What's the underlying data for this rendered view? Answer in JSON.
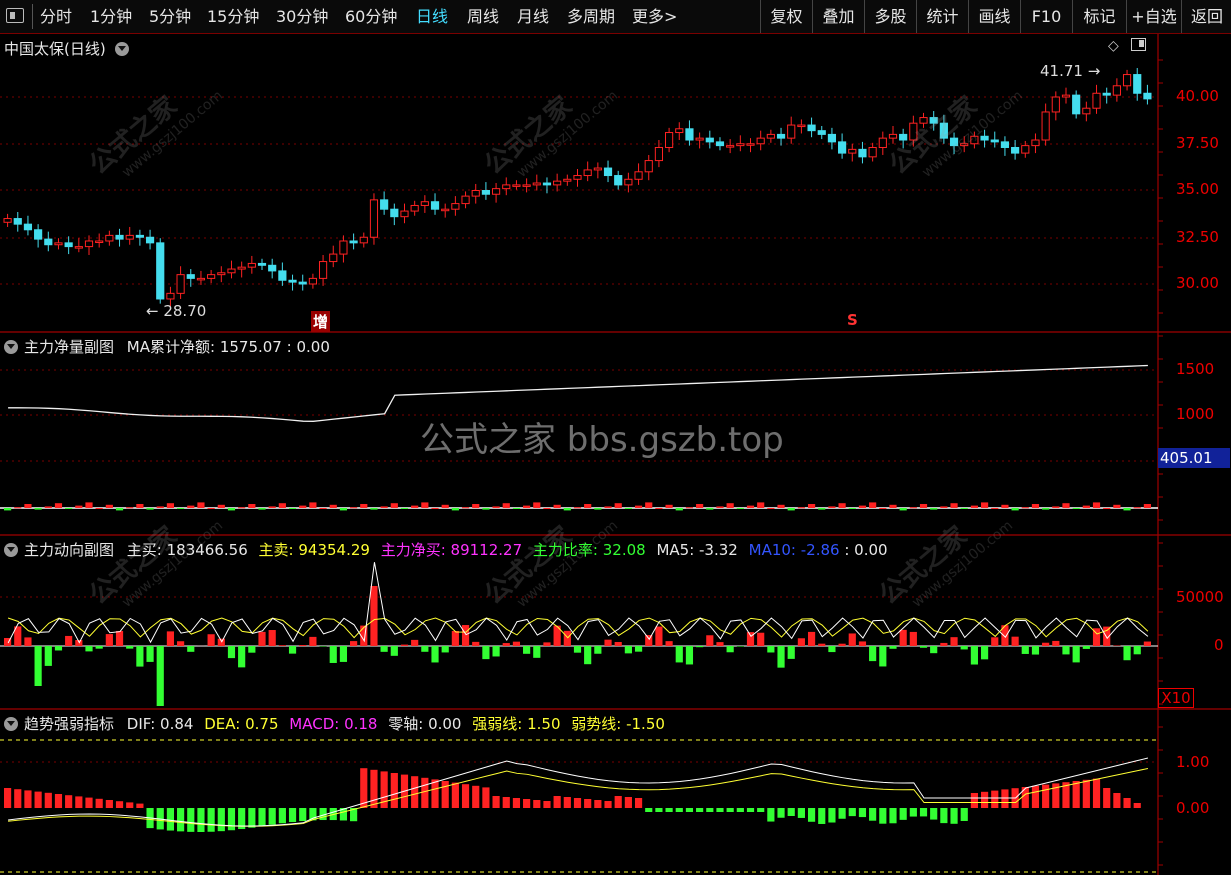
{
  "toolbar": {
    "tabs": [
      "分时",
      "1分钟",
      "5分钟",
      "15分钟",
      "30分钟",
      "60分钟",
      "日线",
      "周线",
      "月线",
      "多周期",
      "更多>"
    ],
    "active": "日线",
    "right": [
      "复权",
      "叠加",
      "多股",
      "统计",
      "画线",
      "F10",
      "标记",
      "+自选",
      "返回"
    ]
  },
  "main": {
    "title": "中国太保(日线)",
    "high_label": "41.71",
    "low_label": "28.70",
    "marker_zeng": "增",
    "marker_s": "S",
    "y_ticks": [
      "40.00",
      "37.50",
      "35.00",
      "32.50",
      "30.00"
    ]
  },
  "p1": {
    "title": "主力净量副图",
    "ma_label": "MA累计净额: 1575.07",
    "zero": ": 0.00",
    "y_ticks": [
      "1500",
      "1000"
    ],
    "box_value": "405.01"
  },
  "p2": {
    "title": "主力动向副图",
    "buy": "主买: 183466.56",
    "sell": "主卖: 94354.29",
    "net": "主力净买: 89112.27",
    "ratio": "主力比率: 32.08",
    "ma5": "MA5: -3.32",
    "ma10": "MA10: -2.86",
    "zero": ": 0.00",
    "y_ticks": [
      "50000",
      "0"
    ],
    "x10": "X10"
  },
  "p3": {
    "title": "趋势强弱指标",
    "dif": "DIF: 0.84",
    "dea": "DEA: 0.75",
    "macd": "MACD: 0.18",
    "zero": "零轴: 0.00",
    "strong": "强弱线: 1.50",
    "weak": "弱势线: -1.50",
    "y_ticks": [
      "1.00",
      "0.00"
    ]
  },
  "watermark": "公式之家 bbs.gszb.top",
  "wm_diag": {
    "cn": "公式之家",
    "url": "www.gszj100.com"
  },
  "colors": {
    "up": "#ff2222",
    "down": "#44ddee",
    "grid": "#7a0000",
    "accent": "#44ddff"
  },
  "chart_data": {
    "type": "candlestick",
    "closes": [
      33.5,
      33.2,
      32.9,
      32.4,
      32.1,
      32.2,
      32.0,
      32.0,
      32.3,
      32.3,
      32.6,
      32.4,
      32.6,
      32.5,
      32.2,
      29.2,
      29.5,
      30.5,
      30.3,
      30.3,
      30.5,
      30.6,
      30.8,
      30.9,
      31.1,
      31.0,
      30.7,
      30.2,
      30.1,
      30.0,
      30.3,
      31.2,
      31.6,
      32.3,
      32.2,
      32.5,
      34.5,
      34.0,
      33.6,
      33.9,
      34.2,
      34.4,
      34.0,
      34.0,
      34.3,
      34.7,
      35.0,
      34.8,
      35.1,
      35.3,
      35.3,
      35.3,
      35.4,
      35.3,
      35.5,
      35.6,
      35.8,
      36.1,
      36.2,
      35.8,
      35.3,
      35.6,
      36.0,
      36.6,
      37.3,
      38.1,
      38.3,
      37.7,
      37.8,
      37.6,
      37.4,
      37.4,
      37.5,
      37.5,
      37.8,
      38.0,
      37.8,
      38.5,
      38.5,
      38.2,
      38.0,
      37.6,
      37.0,
      37.2,
      36.8,
      37.3,
      37.8,
      38.0,
      37.7,
      38.6,
      38.9,
      38.6,
      37.8,
      37.4,
      37.5,
      37.9,
      37.7,
      37.6,
      37.3,
      37.0,
      37.4,
      37.7,
      39.2,
      40.0,
      40.1,
      39.1,
      39.4,
      40.2,
      40.1,
      40.6,
      41.2,
      40.2,
      39.9
    ],
    "pmin": 28.0,
    "pmax": 42.5
  }
}
